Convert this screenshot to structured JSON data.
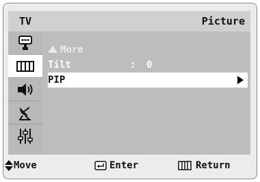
{
  "header": {
    "tab": "TV",
    "title": "Picture"
  },
  "sidebar": {
    "items": [
      {
        "icon": "input-icon"
      },
      {
        "icon": "picture-icon",
        "active": true
      },
      {
        "icon": "sound-icon"
      },
      {
        "icon": "channel-icon"
      },
      {
        "icon": "setup-icon"
      }
    ]
  },
  "menu": {
    "more_label": "More",
    "tilt_label": "Tilt",
    "tilt_separator": ":",
    "tilt_value": "0",
    "pip_label": "PIP"
  },
  "footer": {
    "move_label": "Move",
    "enter_label": "Enter",
    "return_label": "Return"
  }
}
